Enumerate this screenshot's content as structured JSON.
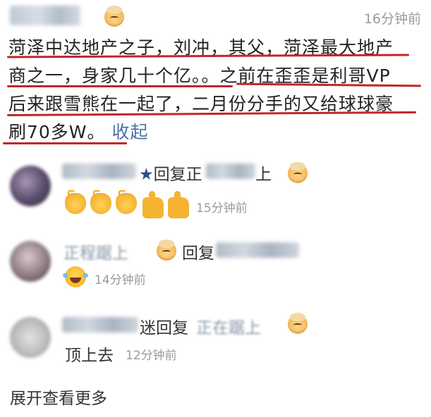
{
  "main_comment": {
    "time": "16分钟前",
    "lines": [
      "菏泽中达地产之子，刘冲，其父，菏泽最大地产",
      "商之一，身家几十个亿。。之前在歪歪是利哥VP",
      "后来跟雪熊在一起了，二月份分手的又给球球豪",
      "刷70多W。"
    ],
    "collapse_label": "收起"
  },
  "replies": [
    {
      "name_suffix": "★",
      "reply_word": "回复",
      "target_prefix": "正",
      "target_suffix": "上",
      "time": "15分钟前",
      "emojis": [
        "clap-emoji",
        "clap-emoji",
        "clap-emoji",
        "thumbs-up-emoji",
        "thumbs-up-emoji"
      ]
    },
    {
      "name_shown": "正程踞上",
      "reply_word": "回复",
      "time": "14分钟前",
      "emojis": [
        "laughing-tears-emoji"
      ]
    },
    {
      "reply_word_full": "迷回复",
      "target_shown": "正在踞上",
      "text": "顶上去",
      "time": "12分钟前"
    }
  ],
  "expand_more_label": "展开查看更多",
  "colors": {
    "underline": "#c2262b",
    "link": "#4a72a8",
    "time": "#9a9a9a"
  }
}
